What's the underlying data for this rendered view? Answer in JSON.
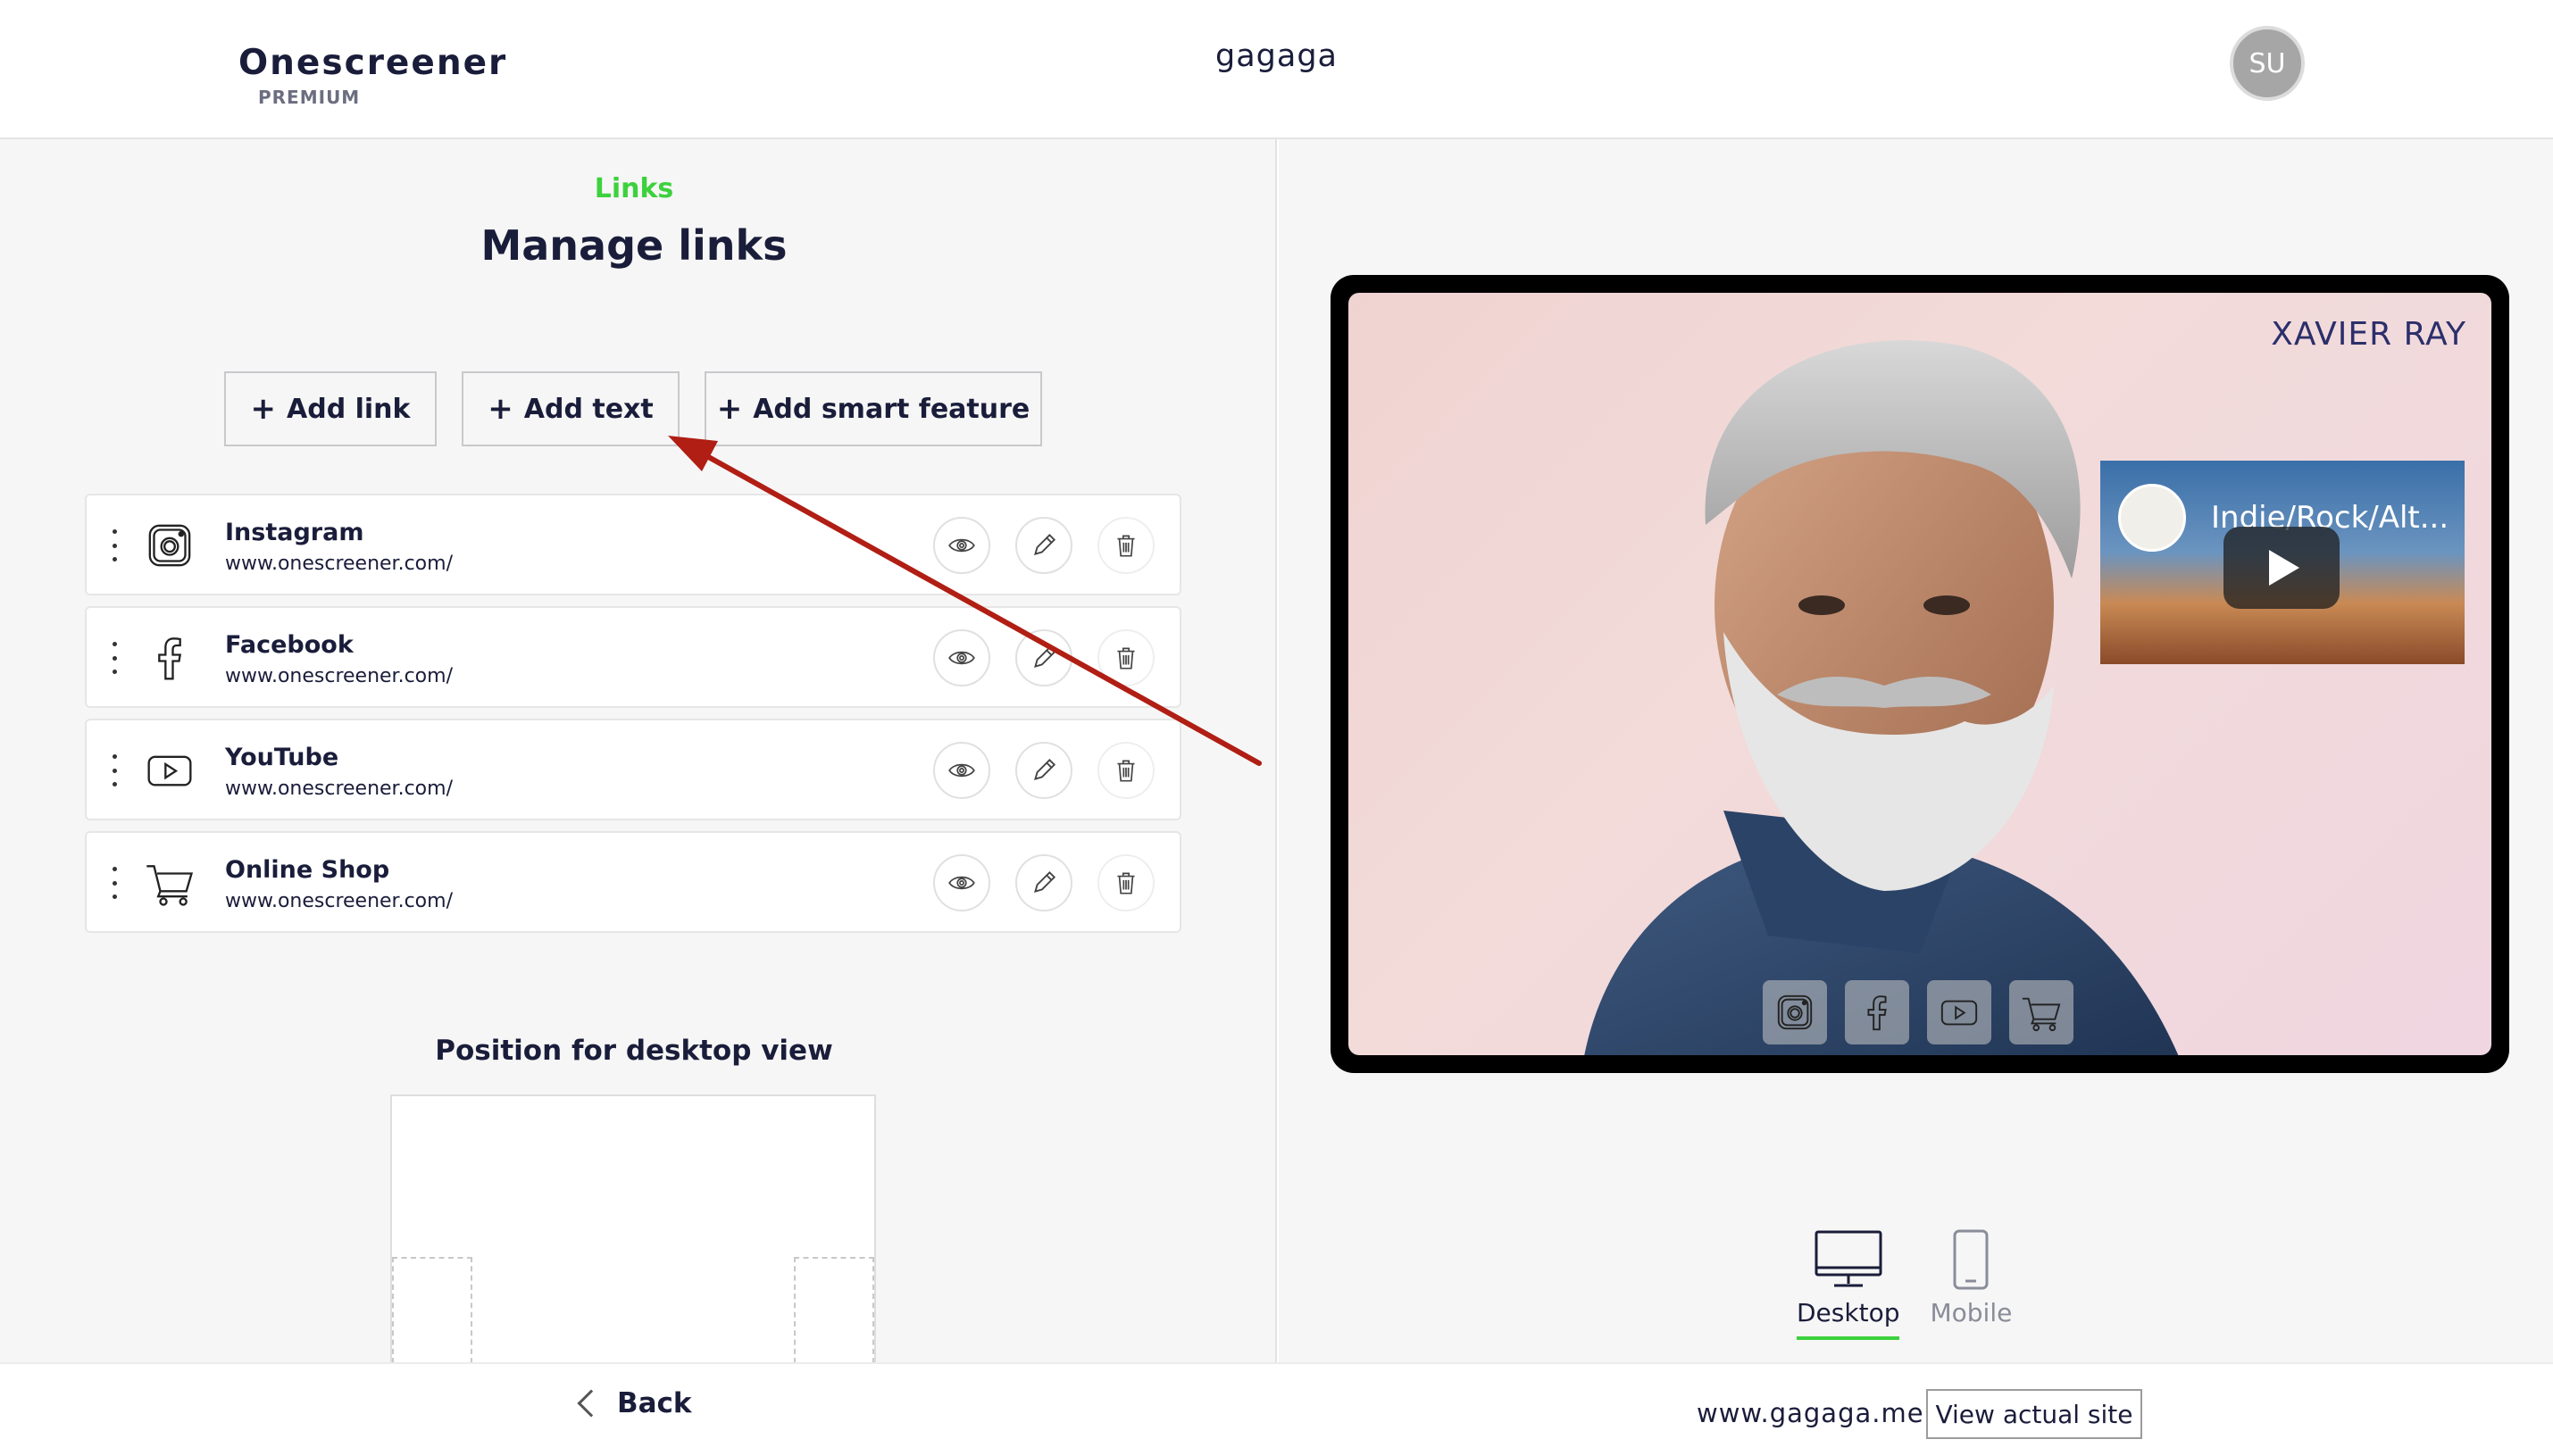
{
  "header": {
    "logo_name": "Onescreener",
    "logo_tier": "PREMIUM",
    "site_name": "gagaga",
    "avatar_initials": "SU"
  },
  "editor": {
    "section_label": "Links",
    "page_title": "Manage links",
    "buttons": {
      "add_link": "Add link",
      "add_text": "Add text",
      "add_smart_feature": "Add smart feature"
    },
    "links": [
      {
        "title": "Instagram",
        "url": "www.onescreener.com/",
        "icon": "instagram-icon"
      },
      {
        "title": "Facebook",
        "url": "www.onescreener.com/",
        "icon": "facebook-icon"
      },
      {
        "title": "YouTube",
        "url": "www.onescreener.com/",
        "icon": "youtube-icon"
      },
      {
        "title": "Online Shop",
        "url": "www.onescreener.com/",
        "icon": "cart-icon"
      }
    ],
    "position_title": "Position for desktop view"
  },
  "preview": {
    "site_title": "XAVIER RAY",
    "video_title": "Indie/Rock/Alt...",
    "view_options": [
      {
        "label": "Desktop",
        "active": true
      },
      {
        "label": "Mobile",
        "active": false
      }
    ]
  },
  "footer": {
    "back_label": "Back",
    "domain": "www.gagaga.me",
    "view_site_label": "View actual site"
  },
  "colors": {
    "accent": "#3dd13d",
    "text_primary": "#1a1d3a",
    "annotation_arrow": "#b01e14"
  }
}
